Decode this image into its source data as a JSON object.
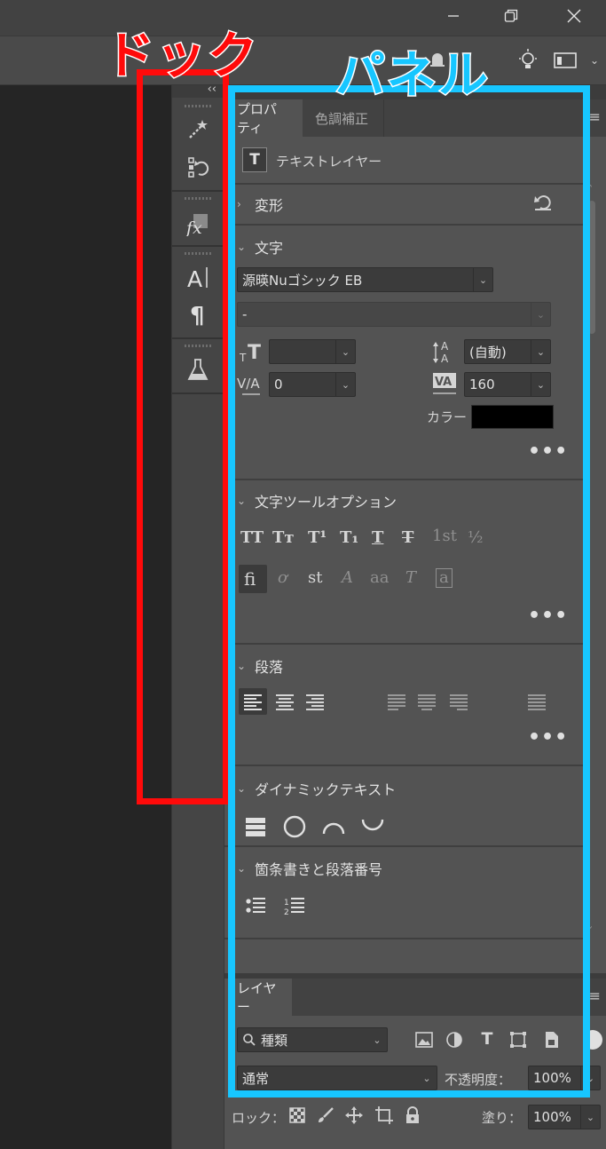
{
  "annotations": {
    "dock_label": "ドック",
    "panel_label": "パネル",
    "dock_color": "#ff0a0a",
    "panel_color": "#17c6ff"
  },
  "window": {
    "minimize_icon": "minimize-icon",
    "restore_icon": "restore-icon",
    "close_icon": "close-icon"
  },
  "optionsbar": {
    "icons": [
      "bell-icon",
      "lightbulb-icon",
      "workspace-icon",
      "chevron-down-icon"
    ]
  },
  "dock": {
    "collapse_label": "‹‹",
    "icons": [
      "magic-select-icon",
      "history-icon",
      "fx-style-icon",
      "character-icon",
      "paragraph-icon",
      "flask-icon"
    ]
  },
  "properties": {
    "tabs": [
      "プロパティ",
      "色調補正"
    ],
    "layer_type": "テキストレイヤー",
    "sections": {
      "transform": "変形",
      "character": "文字",
      "char_tool_options": "文字ツールオプション",
      "paragraph": "段落",
      "dynamic_text": "ダイナミックテキスト",
      "bullets": "箇条書きと段落番号"
    },
    "font_family": "源暎Nuゴシック EB",
    "font_style": "-",
    "font_size": "",
    "leading": "(自動)",
    "kerning": "0",
    "tracking": "160",
    "color_label": "カラー",
    "color_value": "#000000",
    "more": "•••",
    "char_options_row1": [
      "TT",
      "Tт",
      "T¹",
      "T₁",
      "T",
      "T",
      "1st",
      "½"
    ],
    "char_options_row2": [
      "fi",
      "ơ",
      "st",
      "A",
      "aa",
      "T",
      "a"
    ]
  },
  "layers": {
    "tab": "レイヤー",
    "filter_label": "種類",
    "blend_mode": "通常",
    "opacity_label": "不透明度：",
    "opacity_value": "100%",
    "lock_label": "ロック：",
    "fill_label": "塗り：",
    "fill_value": "100%"
  }
}
